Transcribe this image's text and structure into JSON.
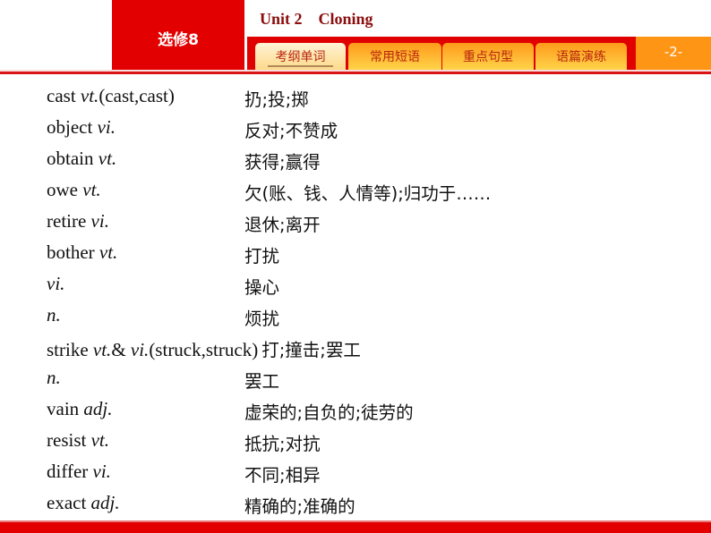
{
  "header": {
    "series_label": "选修8",
    "unit_title": "Unit 2    Cloning",
    "tabs": [
      {
        "label": "考纲单词",
        "active": true
      },
      {
        "label": "常用短语",
        "active": false
      },
      {
        "label": "重点句型",
        "active": false
      },
      {
        "label": "语篇演练",
        "active": false
      }
    ],
    "page_number": "-2-"
  },
  "vocab": [
    {
      "word": "cast ",
      "pos": "vt.",
      "extra": "(cast,cast)",
      "meaning": "扔;投;掷"
    },
    {
      "word": "object ",
      "pos": "vi.",
      "extra": "",
      "meaning": "反对;不赞成"
    },
    {
      "word": "obtain ",
      "pos": "vt.",
      "extra": "",
      "meaning": "获得;赢得"
    },
    {
      "word": "owe ",
      "pos": "vt.",
      "extra": "",
      "meaning": "欠(账、钱、人情等);归功于……"
    },
    {
      "word": "retire ",
      "pos": "vi.",
      "extra": "",
      "meaning": "退休;离开"
    },
    {
      "word": "bother ",
      "pos": "vt.",
      "extra": "",
      "meaning": "打扰"
    },
    {
      "word": "",
      "pos": "vi.",
      "extra": "",
      "meaning": "操心"
    },
    {
      "word": "",
      "pos": "n.",
      "extra": "",
      "meaning": "烦扰"
    },
    {
      "word": "strike ",
      "pos": "vt.",
      "pos_join": "& ",
      "pos2": "vi.",
      "extra": "(struck,struck)",
      "meaning": "打;撞击;罢工"
    },
    {
      "word": "",
      "pos": "n.",
      "extra": "",
      "meaning": "罢工"
    },
    {
      "word": "vain ",
      "pos": "adj.",
      "extra": "",
      "meaning": "虚荣的;自负的;徒劳的"
    },
    {
      "word": "resist ",
      "pos": "vt.",
      "extra": "",
      "meaning": "抵抗;对抗"
    },
    {
      "word": "differ ",
      "pos": "vi.",
      "extra": "",
      "meaning": "不同;相异"
    },
    {
      "word": "exact ",
      "pos": "adj.",
      "extra": "",
      "meaning": "精确的;准确的"
    }
  ]
}
